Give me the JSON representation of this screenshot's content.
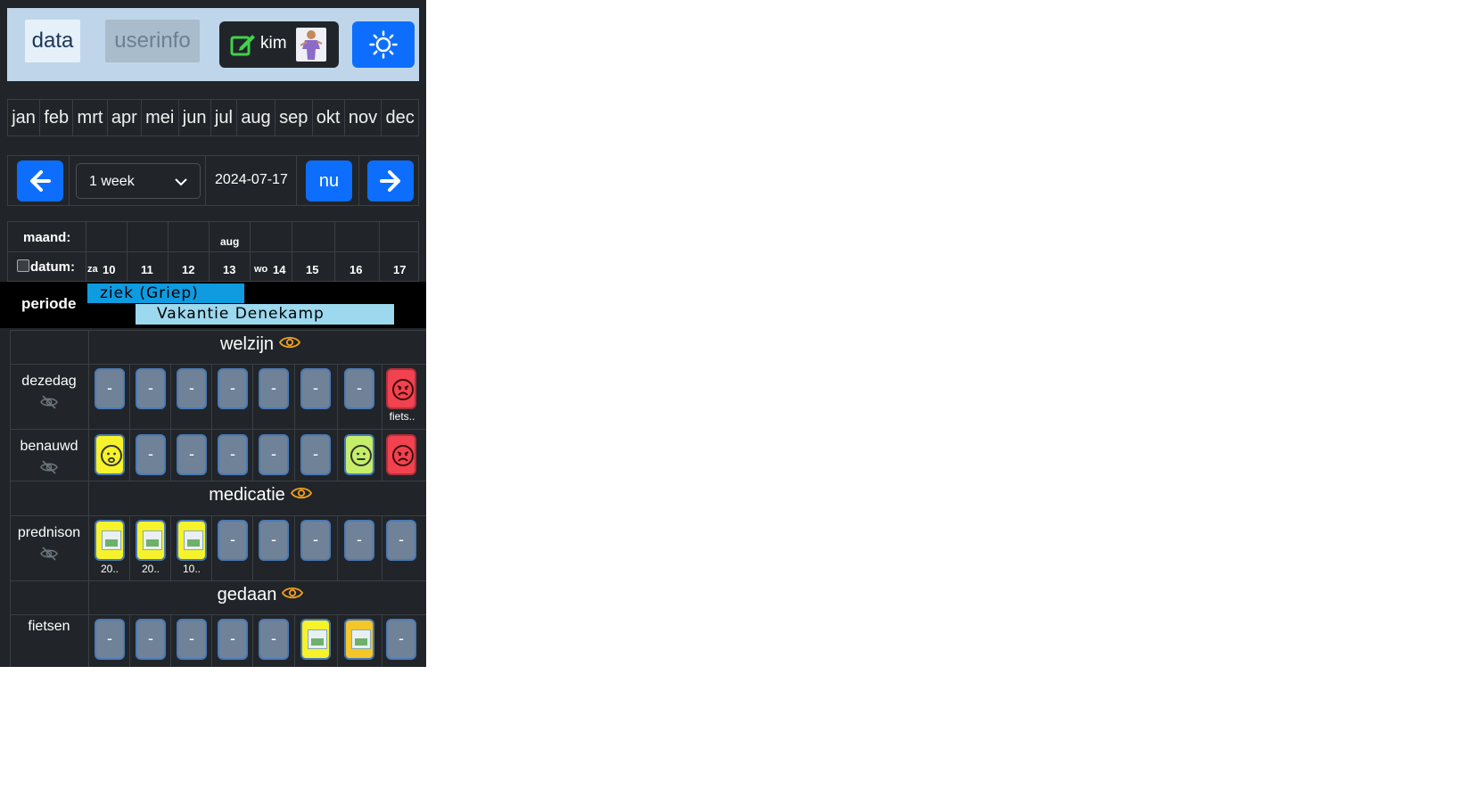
{
  "nav": {
    "data_tab": "data",
    "userinfo_tab": "userinfo",
    "user_name": "kim"
  },
  "months": [
    "jan",
    "feb",
    "mrt",
    "apr",
    "mei",
    "jun",
    "jul",
    "aug",
    "sep",
    "okt",
    "nov",
    "dec"
  ],
  "datenav": {
    "range_value": "1 week",
    "date": "2024-07-17",
    "now_label": "nu"
  },
  "calendar": {
    "month_label": "maand:",
    "date_label": "datum:",
    "month_name": "aug",
    "days": [
      {
        "wd": "za",
        "d": "10"
      },
      {
        "wd": "",
        "d": "11"
      },
      {
        "wd": "",
        "d": "12"
      },
      {
        "wd": "",
        "d": "13"
      },
      {
        "wd": "wo",
        "d": "14"
      },
      {
        "wd": "",
        "d": "15"
      },
      {
        "wd": "",
        "d": "16"
      },
      {
        "wd": "",
        "d": "17"
      }
    ]
  },
  "periods": {
    "label": "periode",
    "items": [
      "ziek (Griep)",
      "Vakantie Denekamp"
    ]
  },
  "sections": [
    {
      "title": "welzijn",
      "rows": [
        {
          "label": "dezedag",
          "cells": [
            "-",
            "-",
            "-",
            "-",
            "-",
            "-",
            "-",
            "angry"
          ],
          "caps": [
            "",
            "",
            "",
            "",
            "",
            "",
            "",
            "fiets.."
          ]
        },
        {
          "label": "benauwd",
          "cells": [
            "sad",
            "-",
            "-",
            "-",
            "-",
            "-",
            "neutral",
            "angry"
          ]
        }
      ]
    },
    {
      "title": "medicatie",
      "rows": [
        {
          "label": "prednison",
          "cells": [
            "img",
            "img",
            "img",
            "-",
            "-",
            "-",
            "-",
            "-"
          ],
          "caps": [
            "20..",
            "20..",
            "10..",
            "",
            "",
            "",
            "",
            ""
          ]
        }
      ]
    },
    {
      "title": "gedaan",
      "rows": [
        {
          "label": "fietsen",
          "cells": [
            "-",
            "-",
            "-",
            "-",
            "-",
            "img",
            "img",
            "-"
          ]
        }
      ]
    }
  ],
  "colors": {
    "accent": "#0d6efd",
    "background": "#212529",
    "eye_icon": "#f0a020",
    "red_tile": "#f2424f",
    "yellow_tile": "#f6f22c"
  }
}
